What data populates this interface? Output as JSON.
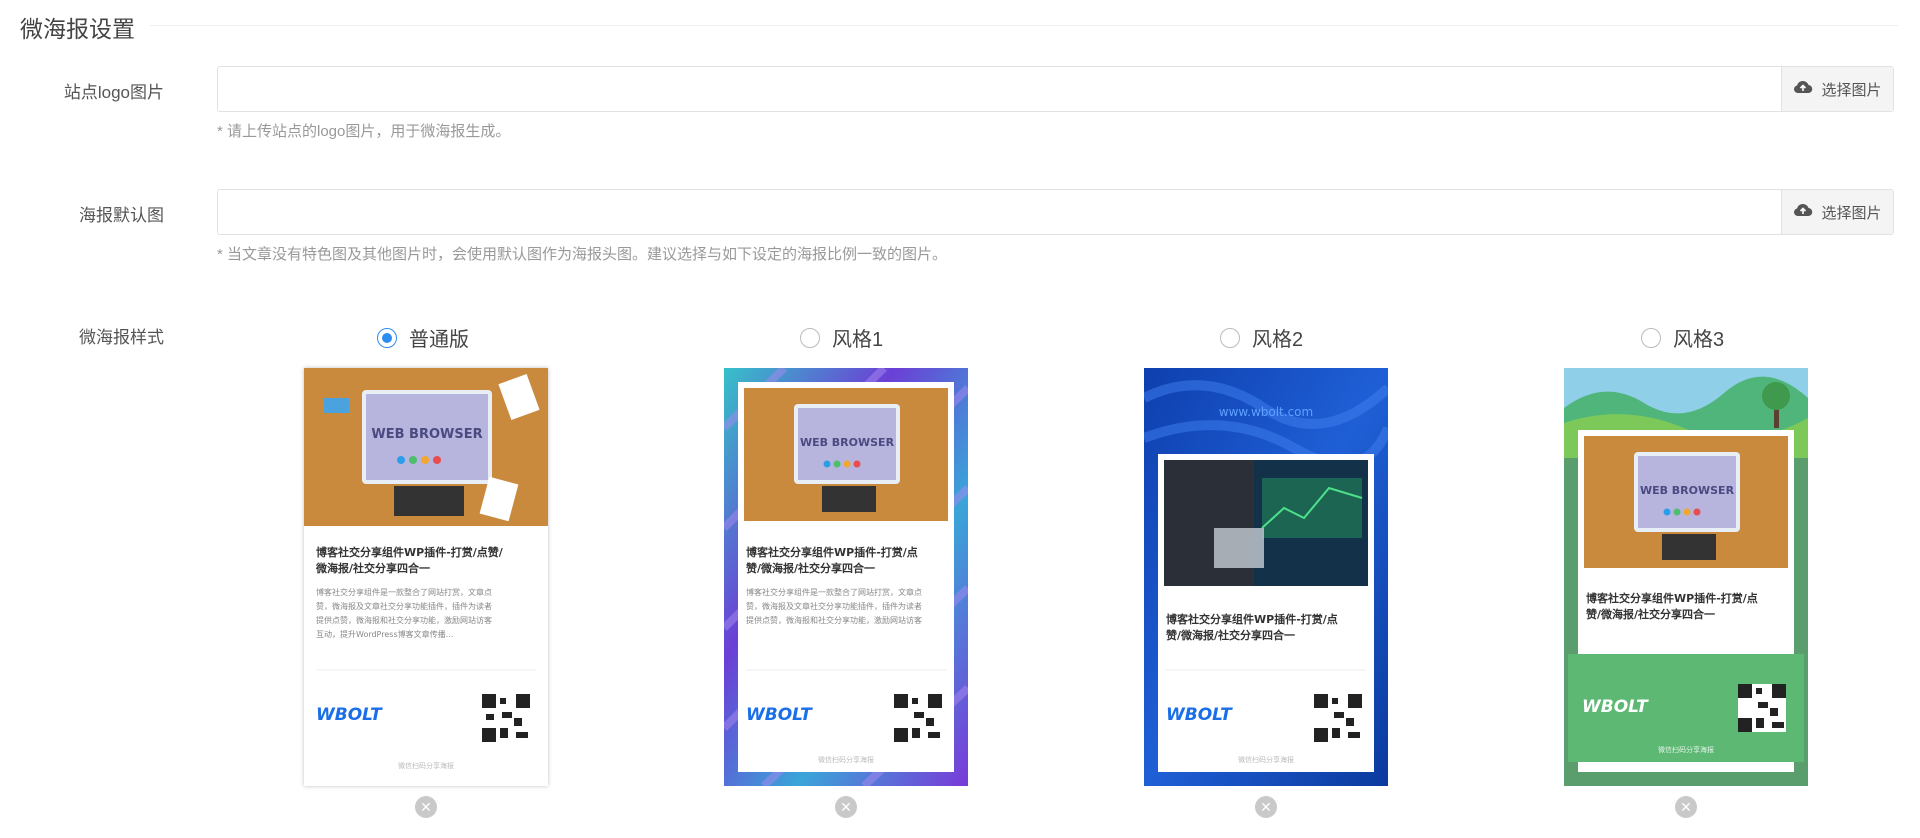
{
  "section_title": "微海报设置",
  "logo_field": {
    "label": "站点logo图片",
    "button": "选择图片",
    "hint": "* 请上传站点的logo图片，用于微海报生成。"
  },
  "default_image_field": {
    "label": "海报默认图",
    "button": "选择图片",
    "hint": "* 当文章没有特色图及其他图片时，会使用默认图作为海报头图。建议选择与如下设定的海报比例一致的图片。"
  },
  "style_field": {
    "label": "微海报样式",
    "options": [
      {
        "label": "普通版",
        "checked": true
      },
      {
        "label": "风格1",
        "checked": false
      },
      {
        "label": "风格2",
        "checked": false
      },
      {
        "label": "风格3",
        "checked": false
      }
    ]
  },
  "poster_preview": {
    "browser_text": "WEB BROWSER",
    "site_url": "www.wbolt.com",
    "title_a": "博客社交分享组件WP插件-打赏/点赞/",
    "title_b": "微海报/社交分享四合一",
    "title_alt_a": "博客社交分享组件WP插件-打赏/点",
    "title_alt_b": "赞/微海报/社交分享四合一",
    "desc_1": "博客社交分享组件是一款整合了网站打赏，文章点",
    "desc_2": "赞，微海报及文章社交分享功能插件，插件为读者",
    "desc_3": "提供点赞，微海报和社交分享功能，激励网站访客",
    "desc_4": "互动，提升WordPress博客文章传播...",
    "logo": "WBOLT",
    "scan_text": "微信扫码分享海报"
  },
  "colors": {
    "accent": "#2d8cf0",
    "logo_blue": "#1a6fe8",
    "style2_blue": "#1546b8",
    "style3_green": "#5cb873"
  },
  "icons": {
    "upload": "cloud-upload-icon",
    "remove": "close-icon"
  }
}
